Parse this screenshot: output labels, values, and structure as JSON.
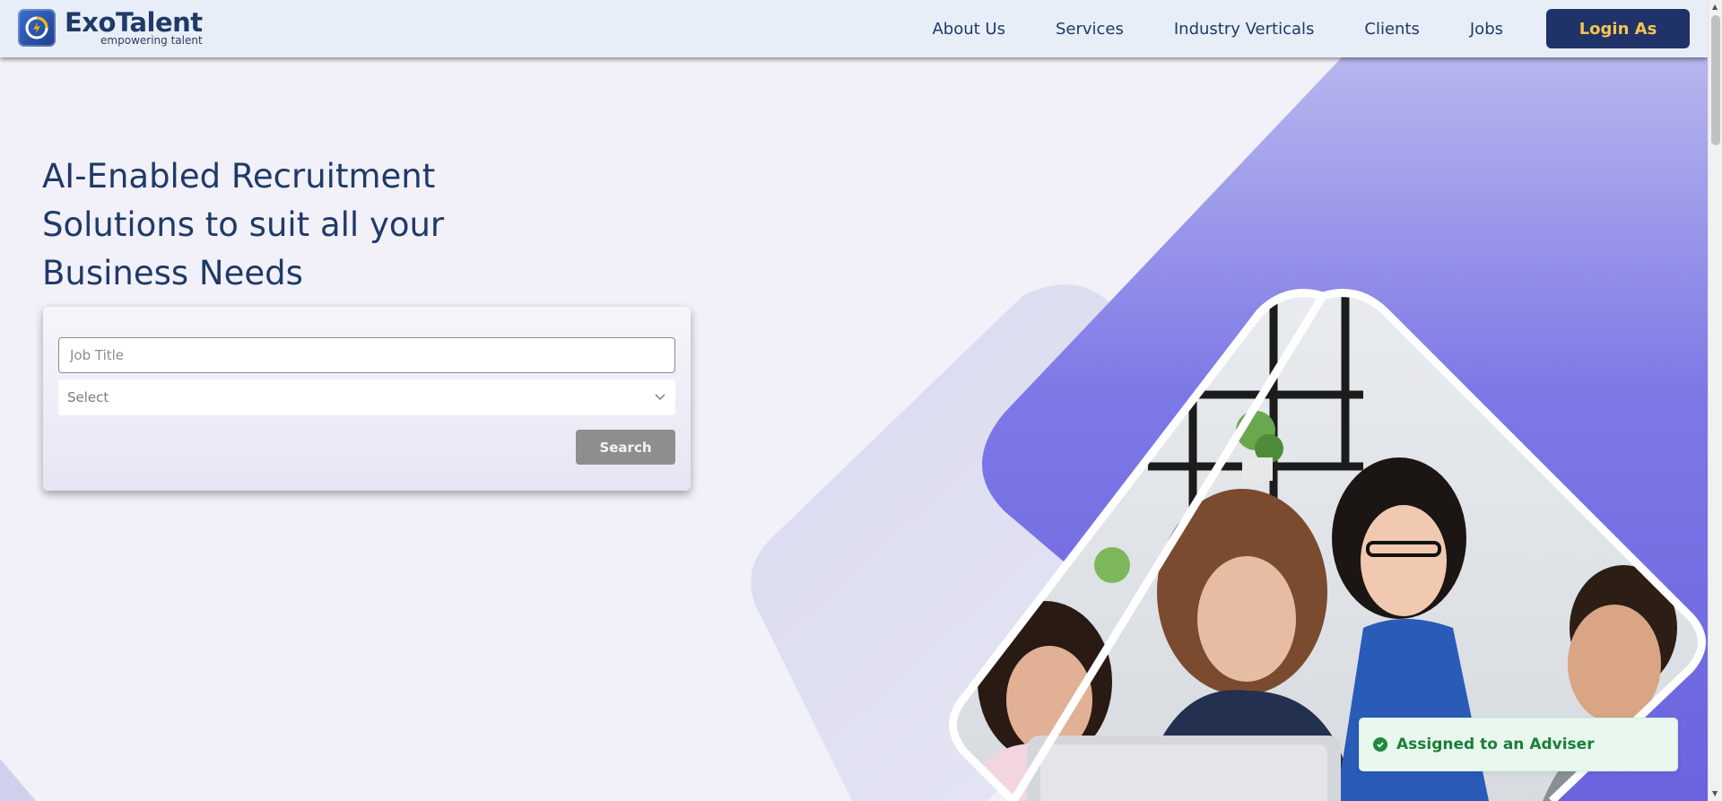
{
  "brand": {
    "name": "ExoTalent",
    "tagline": "empowering talent"
  },
  "nav": {
    "links": [
      "About Us",
      "Services",
      "Industry Verticals",
      "Clients",
      "Jobs"
    ],
    "login_label": "Login As"
  },
  "hero": {
    "headline_line1": "AI-Enabled Recruitment",
    "headline_line2": "Solutions to suit all your",
    "headline_line3": "Business Needs"
  },
  "search": {
    "job_title_placeholder": "Job Title",
    "select_value": "Select",
    "button_label": "Search"
  },
  "toast": {
    "message": "Assigned to an Adviser"
  },
  "colors": {
    "brand_navy": "#1f3368",
    "login_text": "#f5c452",
    "purple_accent": "#6f69e0",
    "toast_green": "#1b7f36"
  },
  "icons": [
    "exotalent-logo-icon",
    "chevron-down-icon",
    "check-circle-icon",
    "scroll-up-icon",
    "scroll-down-icon"
  ]
}
